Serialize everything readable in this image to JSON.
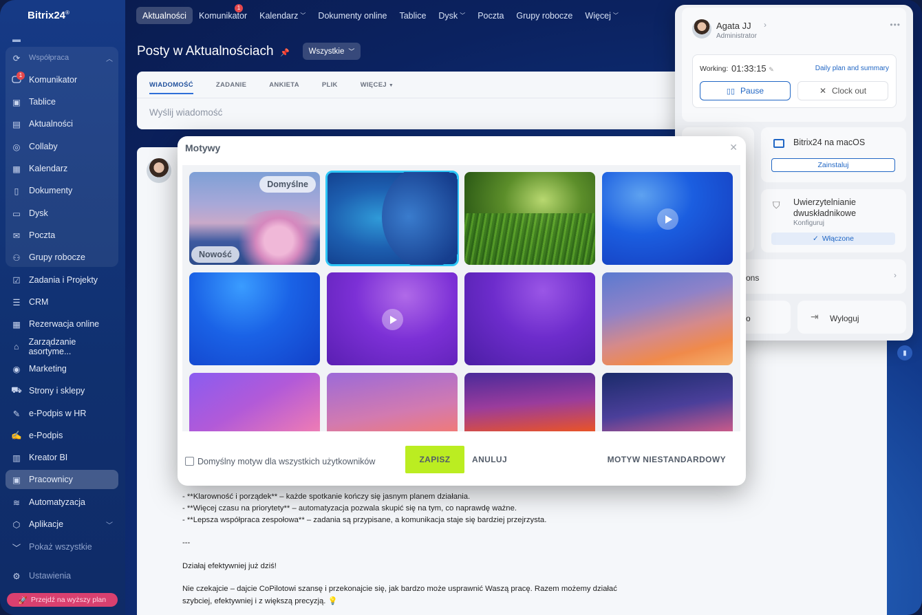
{
  "app": {
    "name": "Bitrix24",
    "mark": "®"
  },
  "sidebar": {
    "items": [
      {
        "label": "Współpraca",
        "icon": "collab-icon"
      },
      {
        "label": "Komunikator",
        "icon": "chat-icon",
        "badge": "1"
      },
      {
        "label": "Tablice",
        "icon": "board-icon"
      },
      {
        "label": "Aktualności",
        "icon": "news-icon"
      },
      {
        "label": "Collaby",
        "icon": "collaby-icon"
      },
      {
        "label": "Kalendarz",
        "icon": "calendar-icon"
      },
      {
        "label": "Dokumenty",
        "icon": "document-icon"
      },
      {
        "label": "Dysk",
        "icon": "drive-icon"
      },
      {
        "label": "Poczta",
        "icon": "mail-icon"
      },
      {
        "label": "Grupy robocze",
        "icon": "group-icon"
      },
      {
        "label": "Zadania i Projekty",
        "icon": "tasks-icon"
      },
      {
        "label": "CRM",
        "icon": "crm-icon"
      },
      {
        "label": "Rezerwacja online",
        "icon": "booking-icon"
      },
      {
        "label": "Zarządzanie asortyme...",
        "icon": "inventory-icon"
      },
      {
        "label": "Marketing",
        "icon": "marketing-icon"
      },
      {
        "label": "Strony i sklepy",
        "icon": "shop-icon"
      },
      {
        "label": "e-Podpis w HR",
        "icon": "hr-sign-icon"
      },
      {
        "label": "e-Podpis",
        "icon": "sign-icon"
      },
      {
        "label": "Kreator BI",
        "icon": "bi-icon"
      },
      {
        "label": "Pracownicy",
        "icon": "employees-icon"
      },
      {
        "label": "Automatyzacja",
        "icon": "automation-icon"
      },
      {
        "label": "Aplikacje",
        "icon": "apps-icon"
      },
      {
        "label": "Pokaż wszystkie",
        "icon": "chevron-down-icon"
      },
      {
        "label": "Ustawienia",
        "icon": "settings-icon"
      }
    ],
    "upgrade": "Przejdź na wyższy plan"
  },
  "topnav": {
    "tabs": [
      "Aktualności",
      "Komunikator",
      "Kalendarz",
      "Dokumenty online",
      "Tablice",
      "Dysk",
      "Poczta",
      "Grupy robocze",
      "Więcej"
    ],
    "komunikator_badge": "1"
  },
  "page": {
    "title": "Posty w Aktualnościach",
    "filter": "Wszystkie"
  },
  "composer": {
    "tabs": [
      "WIADOMOŚĆ",
      "ZADANIE",
      "ANKIETA",
      "PLIK",
      "WIĘCEJ"
    ],
    "placeholder": "Wyślij wiadomość"
  },
  "post": {
    "lines": [
      "- **Klarowność i porządek** – każde spotkanie kończy się jasnym planem działania.",
      "- **Więcej czasu na priorytety** – automatyzacja pozwala skupić się na tym, co naprawdę ważne.",
      "- **Lepsza współpraca zespołowa** – zadania są przypisane, a komunikacja staje się bardziej przejrzysta.",
      "---",
      "Działaj efektywniej już dziś!",
      "Nie czekajcie – dajcie CoPilotowi szansę i przekonajcie się, jak bardzo może usprawnić Waszą pracę. Razem możemy działać",
      "szybciej, efektywniej i z większą precyzją. 💡"
    ]
  },
  "modal": {
    "title": "Motywy",
    "tag_default": "Domyślne",
    "tag_new": "Nowość",
    "checkbox_label": "Domyślny motyw dla wszystkich użytkowników",
    "save": "ZAPISZ",
    "cancel": "ANULUJ",
    "custom": "MOTYW NIESTANDARDOWY"
  },
  "profile": {
    "name": "Agata JJ",
    "role": "Administrator",
    "working_label": "Working:",
    "working_time": "01:33:15",
    "daily_link": "Daily plan and summary",
    "pause": "Pause",
    "clock_out": "Clock out",
    "mac_title": "Bitrix24 na macOS",
    "install": "Zainstaluj",
    "twofa_title_1": "Uwierzytelnianie",
    "twofa_title_2": "dwuskładnikowe",
    "twofa_sub": "Konfiguruj",
    "twofa_status": "Włączone",
    "cut_text_1": "ons",
    "cut_text_2": "o",
    "logout": "Wyloguj"
  },
  "colors": {
    "accent": "#2066c4",
    "save": "#bbed21",
    "selected": "#2fc6f6",
    "badge": "#e5484d"
  }
}
